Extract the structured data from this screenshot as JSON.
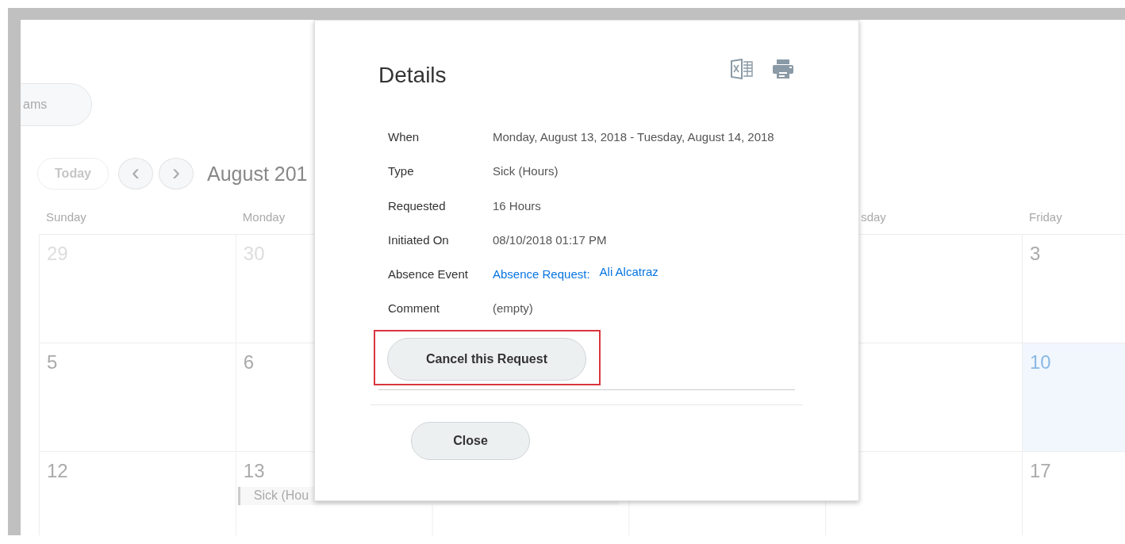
{
  "top_button": {
    "label": "ams"
  },
  "toolbar": {
    "today": "Today",
    "prev": "‹",
    "next": "›",
    "month": "August 201"
  },
  "calendar": {
    "columns": [
      {
        "label": "Sunday",
        "partly_hidden": false
      },
      {
        "label": "Monday",
        "partly_hidden": false
      },
      null,
      null,
      {
        "label": "sday",
        "partly_hidden": true
      },
      {
        "label": "Friday",
        "partly_hidden": false
      }
    ],
    "rows": [
      [
        {
          "day": "29",
          "muted": true,
          "today": false
        },
        {
          "day": "30",
          "muted": true,
          "today": false
        },
        null,
        null,
        null,
        {
          "day": "3",
          "muted": false,
          "today": false
        }
      ],
      [
        {
          "day": "5",
          "muted": false,
          "today": false
        },
        {
          "day": "6",
          "muted": false,
          "today": false
        },
        null,
        null,
        null,
        {
          "day": "10",
          "muted": false,
          "today": true
        }
      ],
      [
        {
          "day": "12",
          "muted": false,
          "today": false
        },
        {
          "day": "13",
          "muted": false,
          "today": false,
          "event": "Sick (Hou"
        },
        null,
        null,
        null,
        {
          "day": "17",
          "muted": false,
          "today": false
        }
      ]
    ]
  },
  "dialog": {
    "title": "Details",
    "fields": [
      {
        "label": "When",
        "value": "Monday, August 13, 2018 - Tuesday, August 14, 2018"
      },
      {
        "label": "Type",
        "value": "Sick (Hours)"
      },
      {
        "label": "Requested",
        "value": "16 Hours"
      },
      {
        "label": "Initiated On",
        "value": "08/10/2018 01:17 PM"
      },
      {
        "label": "Absence Event",
        "links": [
          "Absence Request:",
          "Ali Alcatraz"
        ]
      },
      {
        "label": "Comment",
        "value": "(empty)"
      }
    ],
    "action": {
      "label": "Cancel this Request",
      "highlighted": true
    },
    "close": "Close"
  }
}
